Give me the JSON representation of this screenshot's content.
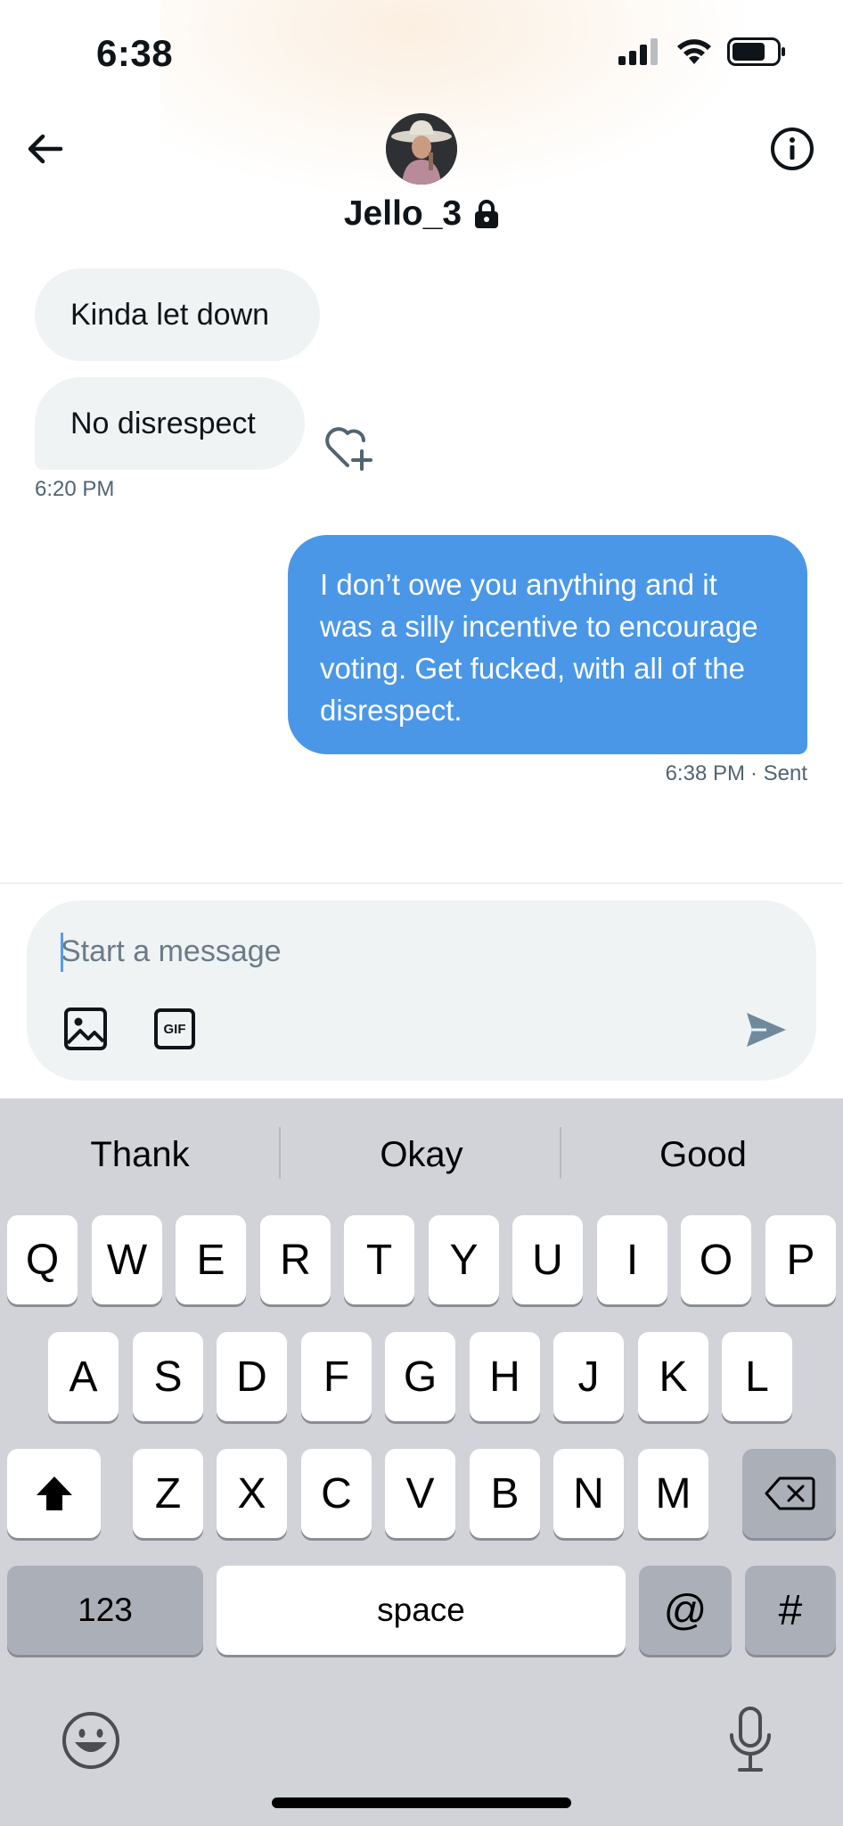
{
  "status_bar": {
    "time": "6:38"
  },
  "header": {
    "username": "Jello_3"
  },
  "messages": [
    {
      "text": "Kinda let down",
      "direction": "incoming"
    },
    {
      "text": "No disrespect",
      "direction": "incoming"
    },
    {
      "text": "I don’t owe you anything and it was a silly incentive to encourage voting. Get fucked, with all of the disrespect.",
      "direction": "outgoing"
    }
  ],
  "timestamps": {
    "incoming": "6:20 PM",
    "outgoing": "6:38 PM",
    "outgoing_status": "· Sent"
  },
  "composer": {
    "placeholder": "Start a message",
    "gif_label": "GIF"
  },
  "keyboard": {
    "suggestions": [
      "Thank",
      "Okay",
      "Good"
    ],
    "row1": [
      "Q",
      "W",
      "E",
      "R",
      "T",
      "Y",
      "U",
      "I",
      "O",
      "P"
    ],
    "row2": [
      "A",
      "S",
      "D",
      "F",
      "G",
      "H",
      "J",
      "K",
      "L"
    ],
    "row3": [
      "Z",
      "X",
      "C",
      "V",
      "B",
      "N",
      "M"
    ],
    "numbers_key": "123",
    "space_key": "space",
    "at_key": "@",
    "hash_key": "#"
  },
  "colors": {
    "accent": "#4a97e8",
    "bubble_in": "#eff3f4",
    "keyboard_bg": "#d1d3d9"
  }
}
